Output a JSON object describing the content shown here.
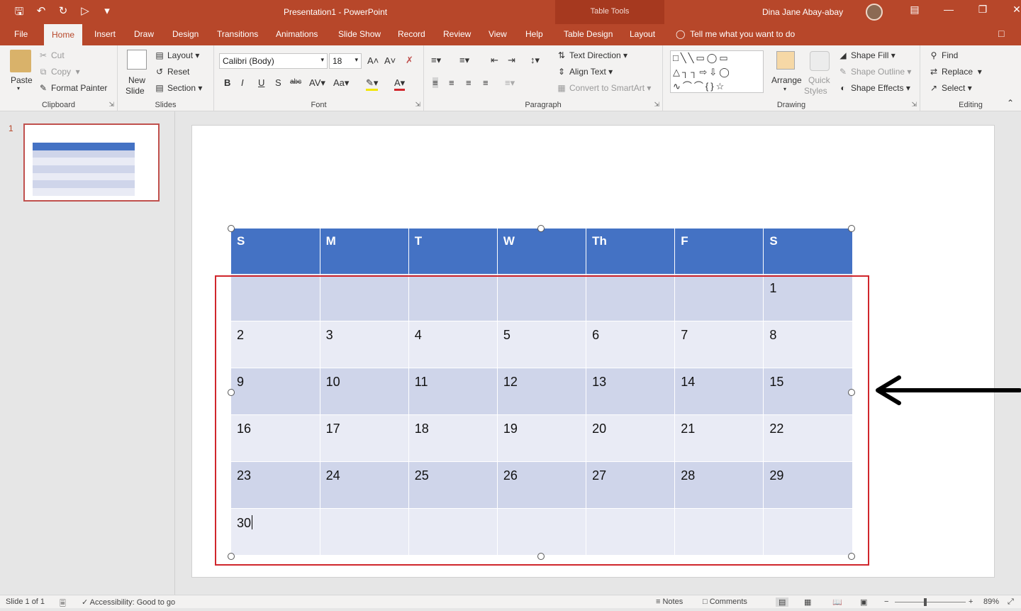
{
  "window": {
    "title": "Presentation1  -  PowerPoint",
    "context_tab_group": "Table Tools",
    "user_name": "Dina Jane Abay-abay"
  },
  "tabs": [
    "File",
    "Home",
    "Insert",
    "Draw",
    "Design",
    "Transitions",
    "Animations",
    "Slide Show",
    "Record",
    "Review",
    "View",
    "Help",
    "Table Design",
    "Layout"
  ],
  "active_tab": "Home",
  "tell_me": "Tell me what you want to do",
  "ribbon": {
    "clipboard": {
      "paste": "Paste",
      "cut": "Cut",
      "copy": "Copy",
      "format_painter": "Format Painter",
      "label": "Clipboard"
    },
    "slides": {
      "new_slide_1": "New",
      "new_slide_2": "Slide",
      "layout": "Layout",
      "reset": "Reset",
      "section": "Section",
      "label": "Slides"
    },
    "font": {
      "name": "Calibri (Body)",
      "size": "18",
      "label": "Font"
    },
    "paragraph": {
      "text_direction": "Text Direction",
      "align_text": "Align Text",
      "convert_smartart": "Convert to SmartArt",
      "label": "Paragraph"
    },
    "drawing": {
      "arrange": "Arrange",
      "quick_1": "Quick",
      "quick_2": "Styles",
      "shape_fill": "Shape Fill",
      "shape_outline": "Shape Outline",
      "shape_effects": "Shape Effects",
      "label": "Drawing"
    },
    "editing": {
      "find": "Find",
      "replace": "Replace",
      "select": "Select",
      "label": "Editing"
    }
  },
  "thumbnail": {
    "number": "1"
  },
  "table": {
    "headers": [
      "S",
      "M",
      "T",
      "W",
      "Th",
      "F",
      "S"
    ],
    "rows": [
      [
        "",
        "",
        "",
        "",
        "",
        "",
        "1"
      ],
      [
        "2",
        "3",
        "4",
        "5",
        "6",
        "7",
        "8"
      ],
      [
        "9",
        "10",
        "11",
        "12",
        "13",
        "14",
        "15"
      ],
      [
        "16",
        "17",
        "18",
        "19",
        "20",
        "21",
        "22"
      ],
      [
        "23",
        "24",
        "25",
        "26",
        "27",
        "28",
        "29"
      ],
      [
        "30",
        "",
        "",
        "",
        "",
        "",
        ""
      ]
    ]
  },
  "colors": {
    "accent": "#b7472a",
    "table_header": "#4472c4",
    "row_dark": "#cfd5ea",
    "row_light": "#e9ebf5",
    "highlight_box": "#d0262c"
  },
  "status": {
    "slide": "Slide 1 of 1",
    "accessibility": "Accessibility: Good to go",
    "notes": "Notes",
    "comments": "Comments",
    "zoom": "89%"
  }
}
